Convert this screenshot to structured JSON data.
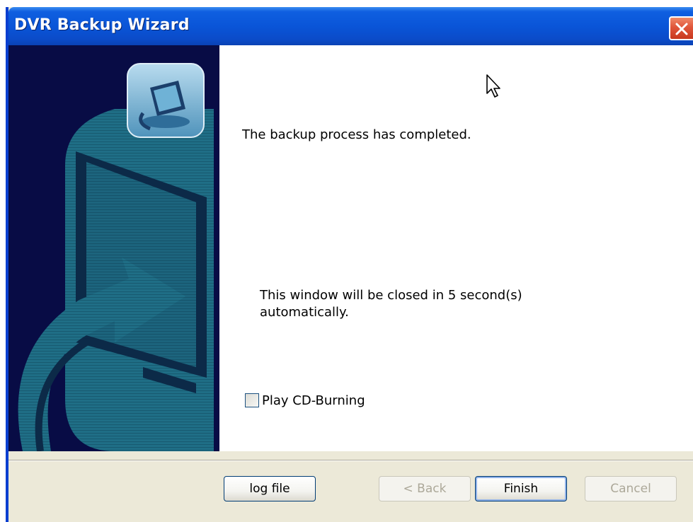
{
  "window": {
    "title": "DVR Backup Wizard"
  },
  "content": {
    "completed_message": "The backup process has completed.",
    "auto_close_message": "This window will be closed in 5 second(s) automatically.",
    "checkbox": {
      "label": "Play CD-Burning",
      "checked": false
    }
  },
  "buttons": {
    "log_file": "log file",
    "back": "< Back",
    "finish": "Finish",
    "cancel": "Cancel"
  },
  "icons": {
    "close": "close-icon",
    "wizard_badge": "computer-backup-icon",
    "banner": "computer-arrow-illustration",
    "cursor": "mouse-pointer-icon"
  },
  "colors": {
    "titlebar": "#0a55d8",
    "side_panel": "#080c45",
    "illustration": "#1f6e86",
    "close_button": "#e0553a"
  }
}
